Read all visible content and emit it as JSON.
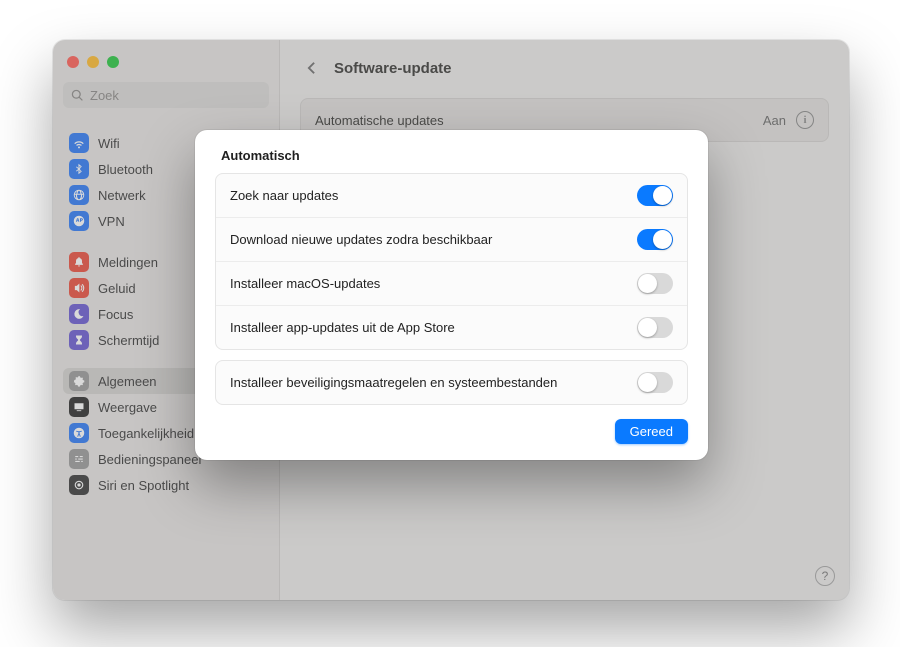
{
  "window": {
    "title": "Software-update",
    "search_placeholder": "Zoek"
  },
  "sidebar": {
    "groups": [
      [
        {
          "label": "Wifi",
          "icon": "wifi",
          "bg": "#2f7bf6"
        },
        {
          "label": "Bluetooth",
          "icon": "bluetooth",
          "bg": "#2f7bf6"
        },
        {
          "label": "Netwerk",
          "icon": "globe",
          "bg": "#2f7bf6"
        },
        {
          "label": "VPN",
          "icon": "vpn",
          "bg": "#2f7bf6"
        }
      ],
      [
        {
          "label": "Meldingen",
          "icon": "bell",
          "bg": "#ea4e3d"
        },
        {
          "label": "Geluid",
          "icon": "sound",
          "bg": "#ea4e3d"
        },
        {
          "label": "Focus",
          "icon": "moon",
          "bg": "#6a5bd1"
        },
        {
          "label": "Schermtijd",
          "icon": "hourglass",
          "bg": "#6a5bd1"
        }
      ],
      [
        {
          "label": "Algemeen",
          "icon": "gear",
          "bg": "#9a9a9a",
          "selected": true
        },
        {
          "label": "Weergave",
          "icon": "display",
          "bg": "#2b2b2b"
        },
        {
          "label": "Toegankelijkheid",
          "icon": "access",
          "bg": "#2f7bf6"
        },
        {
          "label": "Bedieningspaneel",
          "icon": "sliders",
          "bg": "#9a9a9a"
        },
        {
          "label": "Siri en Spotlight",
          "icon": "siri",
          "bg": "#3a3a3a"
        }
      ]
    ]
  },
  "panel": {
    "label": "Automatische updates",
    "value": "Aan"
  },
  "sheet": {
    "title": "Automatisch",
    "options_primary": [
      {
        "label": "Zoek naar updates",
        "on": true
      },
      {
        "label": "Download nieuwe updates zodra beschikbaar",
        "on": true
      },
      {
        "label": "Installeer macOS-updates",
        "on": false
      },
      {
        "label": "Installeer app-updates uit de App Store",
        "on": false
      }
    ],
    "options_secondary": [
      {
        "label": "Installeer beveiligingsmaatregelen en systeembestanden",
        "on": false
      }
    ],
    "done": "Gereed"
  }
}
